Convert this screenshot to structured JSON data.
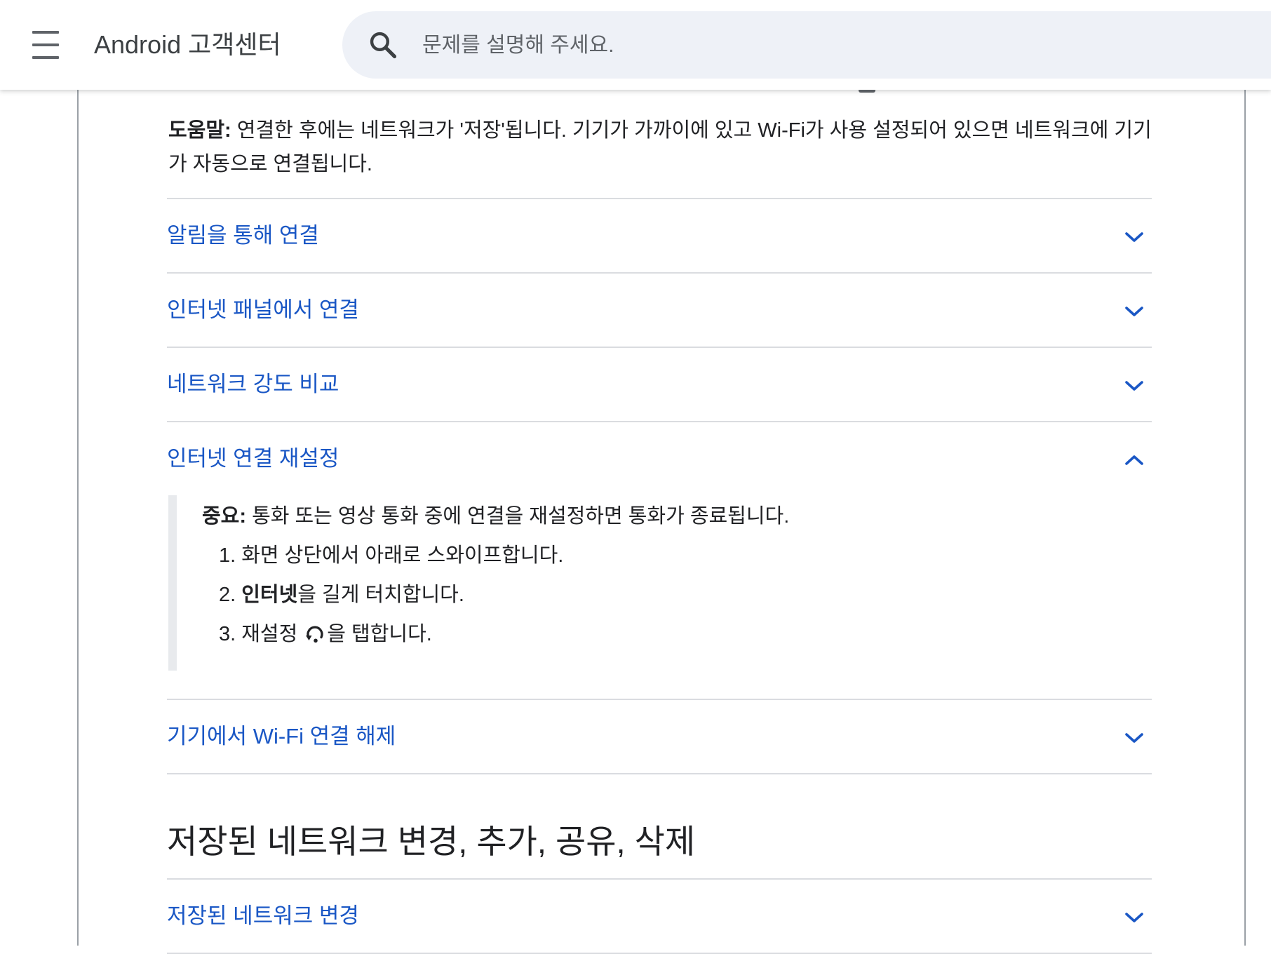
{
  "header": {
    "app_title": "Android 고객센터",
    "search_placeholder": "문제를 설명해 주세요."
  },
  "tip": {
    "label": "도움말:",
    "text": " 연결한 후에는 네트워크가 '저장'됩니다. 기기가 가까이에 있고 Wi-Fi가 사용 설정되어 있으면 네트워크에 기기가 자동으로 연결됩니다."
  },
  "accordion": [
    {
      "label": "알림을 통해 연결",
      "expanded": false
    },
    {
      "label": "인터넷 패널에서 연결",
      "expanded": false
    },
    {
      "label": "네트워크 강도 비교",
      "expanded": false
    },
    {
      "label": "인터넷 연결 재설정",
      "expanded": true
    },
    {
      "label": "기기에서 Wi-Fi 연결 해제",
      "expanded": false
    }
  ],
  "reset_section": {
    "important_label": "중요:",
    "important_text": " 통화 또는 영상 통화 중에 연결을 재설정하면 통화가 종료됩니다.",
    "step1": "1. 화면 상단에서 아래로 스와이프합니다.",
    "step2_prefix": "2. ",
    "step2_bold": "인터넷",
    "step2_suffix": "을 길게 터치합니다.",
    "step3_prefix": "3. 재설정",
    "step3_suffix": "을 탭합니다."
  },
  "section2": {
    "title": "저장된 네트워크 변경, 추가, 공유, 삭제",
    "items": [
      {
        "label": "저장된 네트워크 변경",
        "expanded": false
      }
    ]
  },
  "colors": {
    "link_blue": "#1a57c5",
    "divider": "#dadce0",
    "search_bg": "#eef1f7"
  },
  "icons": {
    "menu": "menu-icon",
    "search": "search-icon",
    "chevron": "chevron-down-icon",
    "reset": "reset-icon"
  }
}
